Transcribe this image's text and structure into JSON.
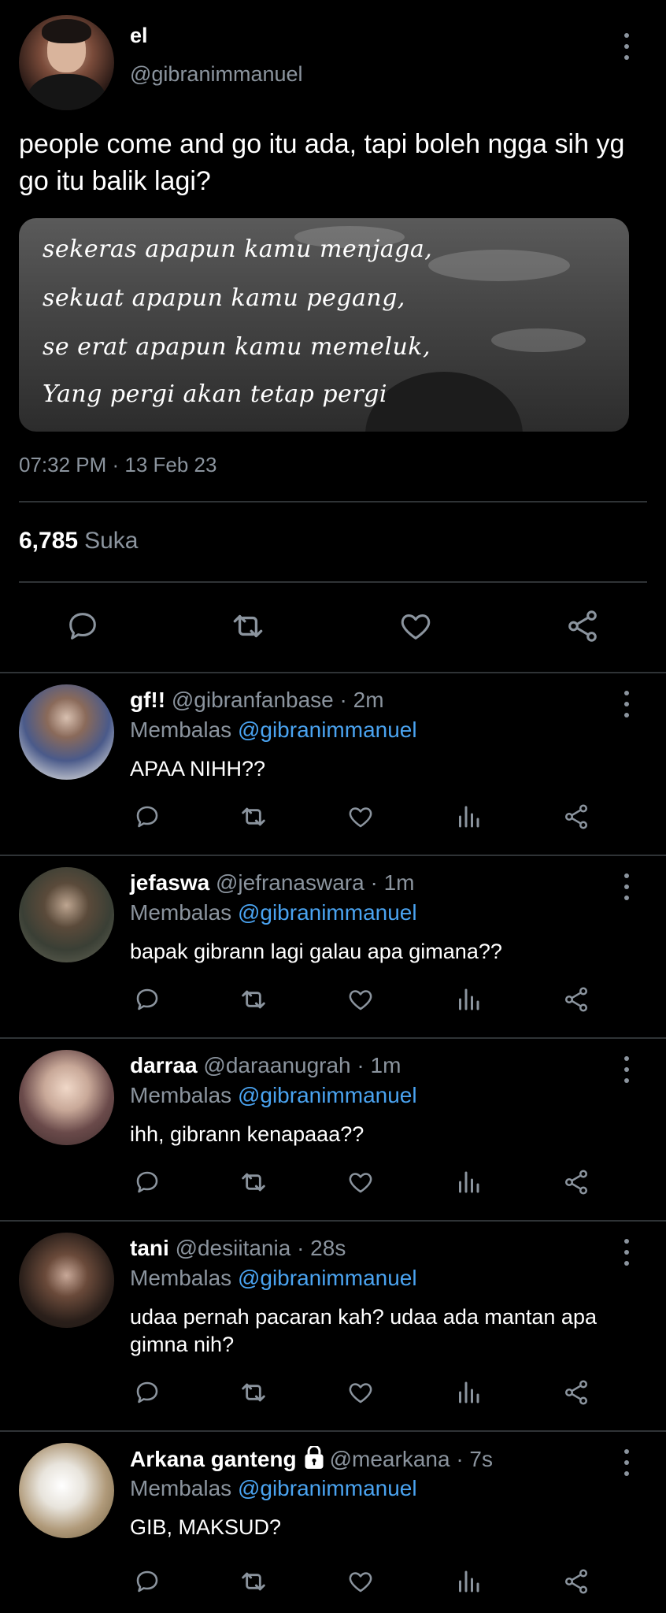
{
  "main": {
    "name": "el",
    "handle": "@gibranimmanuel",
    "text": "people come and go itu ada, tapi boleh ngga sih yg go itu balik lagi?",
    "media_lines": [
      "sekeras apapun kamu menjaga,",
      "sekuat apapun kamu pegang,",
      "se erat apapun kamu memeluk,",
      "Yang pergi akan tetap pergi"
    ],
    "timestamp": "07:32 PM · 13 Feb 23",
    "likes_count": "6,785",
    "likes_label": "Suka"
  },
  "replying_label": "Membalas",
  "replies": [
    {
      "name": "gf!!",
      "handle": "@gibranfanbase",
      "time": "· 2m",
      "mention": "@gibranimmanuel",
      "text": "APAA NIHH??"
    },
    {
      "name": "jefaswa",
      "handle": "@jefranaswara",
      "time": "· 1m",
      "mention": "@gibranimmanuel",
      "text": "bapak gibrann lagi galau apa gimana??"
    },
    {
      "name": "darraa",
      "handle": "@daraanugrah",
      "time": "· 1m",
      "mention": "@gibranimmanuel",
      "text": "ihh, gibrann kenapaaa??"
    },
    {
      "name": "tani",
      "handle": "@desiitania",
      "time": "· 28s",
      "mention": "@gibranimmanuel",
      "text": "udaa pernah pacaran kah? udaa ada mantan apa gimna nih?"
    },
    {
      "name": "Arkana ganteng",
      "handle": "@mearkana",
      "time": "· 7s",
      "mention": "@gibranimmanuel",
      "text": "GIB, MAKSUD?"
    }
  ],
  "colors": {
    "background": "#000000",
    "secondary_text": "#8b949e",
    "mention": "#4aa3f0",
    "divider": "#2f3336"
  },
  "icons": [
    "reply-icon",
    "retweet-icon",
    "like-icon",
    "analytics-icon",
    "share-icon",
    "more-icon",
    "lock-icon"
  ]
}
